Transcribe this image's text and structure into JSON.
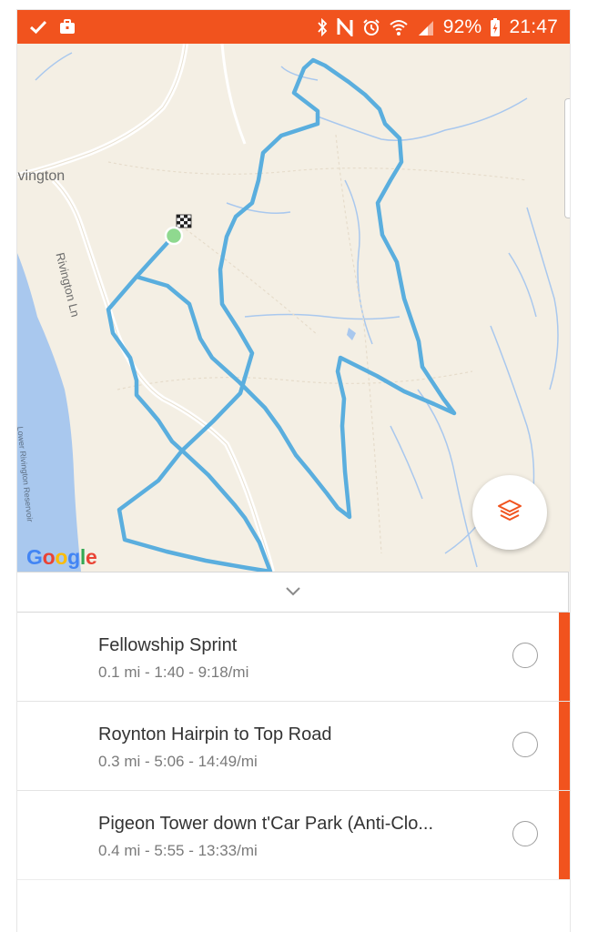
{
  "status_bar": {
    "battery": "92%",
    "time": "21:47",
    "left_icons": [
      "check-icon",
      "briefcase-icon"
    ],
    "right_icons": [
      "bluetooth-icon",
      "nfc-icon",
      "alarm-icon",
      "wifi-icon",
      "signal-icon",
      "battery-charging-icon"
    ]
  },
  "map": {
    "labels": {
      "town": "ivington",
      "lane": "Rivington Ln",
      "reservoir": "Lower Rivington Reservoir"
    },
    "attribution": "Google",
    "colors": {
      "route": "#5aaede",
      "start_marker": "#8fd98f",
      "water": "#a9c8ee",
      "land": "#f4efe4"
    }
  },
  "layers_button": {
    "icon": "layers-icon"
  },
  "collapse": {
    "icon": "chevron-down-icon"
  },
  "segments": [
    {
      "name": "Fellowship Sprint",
      "stats": "0.1 mi - 1:40 - 9:18/mi"
    },
    {
      "name": "Roynton Hairpin to Top Road",
      "stats": "0.3 mi - 5:06 - 14:49/mi"
    },
    {
      "name": "Pigeon Tower down t'Car Park (Anti-Clo...",
      "stats": "0.4 mi - 5:55 - 13:33/mi"
    }
  ],
  "accent_color": "#f1531e"
}
